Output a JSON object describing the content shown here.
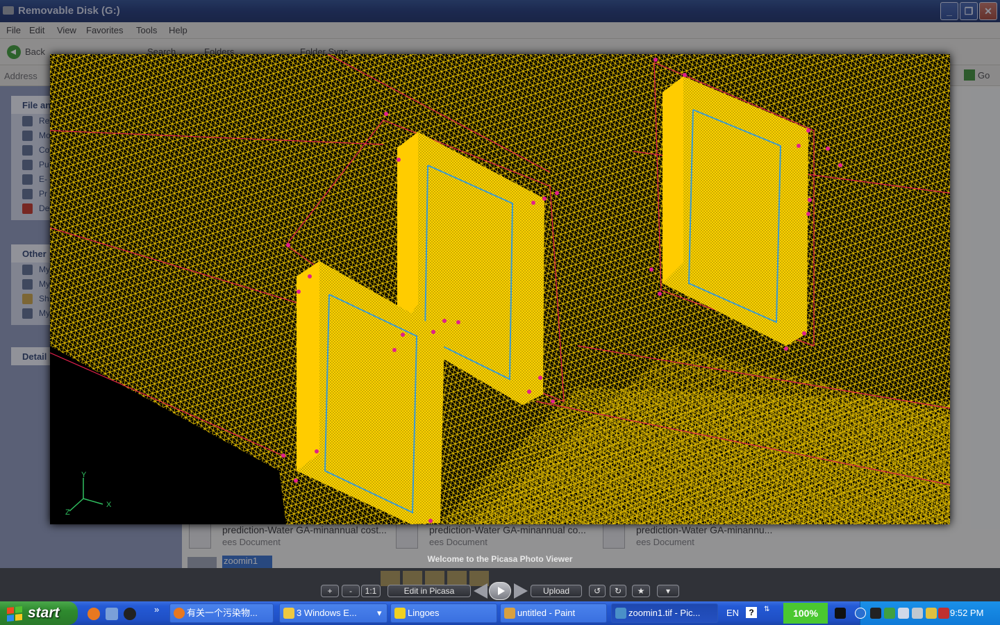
{
  "explorer": {
    "title": "Removable Disk (G:)",
    "menu": [
      "File",
      "Edit",
      "View",
      "Favorites",
      "Tools",
      "Help"
    ],
    "toolbar": {
      "back": "Back",
      "search": "Search",
      "folders": "Folders",
      "folder_sync": "Folder Sync"
    },
    "address_label": "Address",
    "go_label": "Go",
    "panels": {
      "file_tasks": {
        "title": "File an",
        "items": [
          "Re",
          "Mo",
          "Co",
          "Pu",
          "E-",
          "Pr",
          "De"
        ]
      },
      "other_places": {
        "title": "Other",
        "items": [
          "My",
          "My",
          "Sh",
          "My"
        ]
      },
      "details": {
        "title": "Detail"
      }
    },
    "files": [
      {
        "name": "prediction-Water GA-minannual cost...",
        "type": "ees Document"
      },
      {
        "name": "prediction-Water GA-minannual co...",
        "type": "ees Document"
      },
      {
        "name": "prediction-Water GA-minannu...",
        "type": "ees Document"
      }
    ],
    "selected_file": "zoomin1"
  },
  "picasa": {
    "welcome": "Welcome to the Picasa Photo Viewer",
    "buttons": {
      "zoom_in": "+",
      "zoom_out": "-",
      "actual_size": "1:1",
      "edit": "Edit in Picasa",
      "upload": "Upload"
    },
    "axes": {
      "x": "X",
      "y": "Y",
      "z": "Z"
    }
  },
  "taskbar": {
    "start": "start",
    "overflow": "»",
    "tasks": [
      {
        "label": "有关一个污染物...",
        "icon": "firefox-icon"
      },
      {
        "label": "3 Windows E...",
        "icon": "folder-icon"
      },
      {
        "label": "Lingoes",
        "icon": "lingoes-icon"
      },
      {
        "label": "untitled - Paint",
        "icon": "paint-icon"
      },
      {
        "label": "zoomin1.tif - Pic...",
        "icon": "picasa-icon"
      }
    ],
    "lang": "EN",
    "help": "?",
    "zoom": "100%",
    "clock": "9:52 PM"
  },
  "colors": {
    "mesh_yellow": "#ffd400",
    "mesh_red": "#e0204a",
    "mesh_blue": "#3a9ad0",
    "xp_blue": "#245ad6",
    "start_green": "#2e8a2e"
  }
}
